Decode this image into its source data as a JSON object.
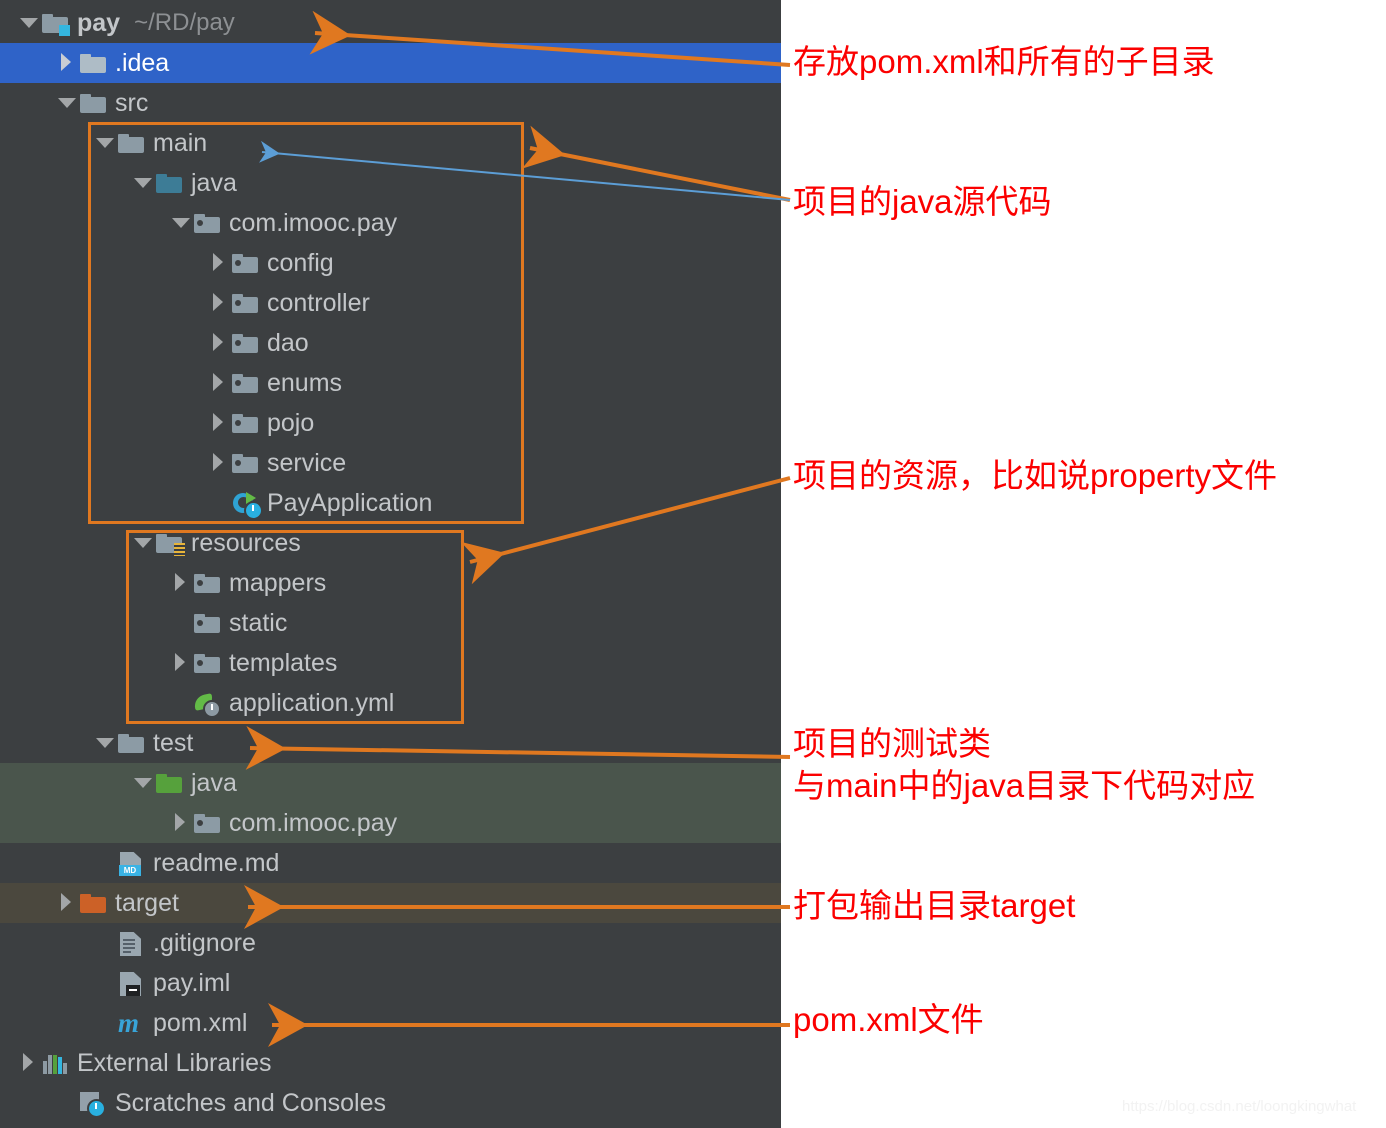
{
  "panel": {
    "background_color": "#3c3f41",
    "selection_color": "#2f63c8",
    "highlight_green": "#4a554c",
    "highlight_brown": "#4b483e"
  },
  "tree": {
    "nodes": [
      {
        "label": "pay",
        "path": "~/RD/pay",
        "icon": "source-root-folder-icon",
        "twisty": "down",
        "indent": 0,
        "state": "normal",
        "bold": true
      },
      {
        "label": ".idea",
        "path": "",
        "icon": "folder-icon",
        "twisty": "right",
        "indent": 1,
        "state": "selected",
        "bold": false
      },
      {
        "label": "src",
        "path": "",
        "icon": "folder-icon",
        "twisty": "down",
        "indent": 1,
        "state": "normal",
        "bold": false
      },
      {
        "label": "main",
        "path": "",
        "icon": "folder-icon",
        "twisty": "down",
        "indent": 2,
        "state": "normal",
        "bold": false
      },
      {
        "label": "java",
        "path": "",
        "icon": "source-folder-icon",
        "twisty": "down",
        "indent": 3,
        "state": "normal",
        "bold": false
      },
      {
        "label": "com.imooc.pay",
        "path": "",
        "icon": "package-icon",
        "twisty": "down",
        "indent": 4,
        "state": "normal",
        "bold": false
      },
      {
        "label": "config",
        "path": "",
        "icon": "package-icon",
        "twisty": "right",
        "indent": 5,
        "state": "normal",
        "bold": false
      },
      {
        "label": "controller",
        "path": "",
        "icon": "package-icon",
        "twisty": "right",
        "indent": 5,
        "state": "normal",
        "bold": false
      },
      {
        "label": "dao",
        "path": "",
        "icon": "package-icon",
        "twisty": "right",
        "indent": 5,
        "state": "normal",
        "bold": false
      },
      {
        "label": "enums",
        "path": "",
        "icon": "package-icon",
        "twisty": "right",
        "indent": 5,
        "state": "normal",
        "bold": false
      },
      {
        "label": "pojo",
        "path": "",
        "icon": "package-icon",
        "twisty": "right",
        "indent": 5,
        "state": "normal",
        "bold": false
      },
      {
        "label": "service",
        "path": "",
        "icon": "package-icon",
        "twisty": "right",
        "indent": 5,
        "state": "normal",
        "bold": false
      },
      {
        "label": "PayApplication",
        "path": "",
        "icon": "spring-boot-class-icon",
        "twisty": "none",
        "indent": 5,
        "state": "normal",
        "bold": false
      },
      {
        "label": "resources",
        "path": "",
        "icon": "resource-root-folder-icon",
        "twisty": "down",
        "indent": 3,
        "state": "normal",
        "bold": false
      },
      {
        "label": "mappers",
        "path": "",
        "icon": "package-icon",
        "twisty": "right",
        "indent": 4,
        "state": "normal",
        "bold": false
      },
      {
        "label": "static",
        "path": "",
        "icon": "package-icon",
        "twisty": "none",
        "indent": 4,
        "state": "normal",
        "bold": false
      },
      {
        "label": "templates",
        "path": "",
        "icon": "package-icon",
        "twisty": "right",
        "indent": 4,
        "state": "normal",
        "bold": false
      },
      {
        "label": "application.yml",
        "path": "",
        "icon": "spring-yaml-icon",
        "twisty": "none",
        "indent": 4,
        "state": "normal",
        "bold": false
      },
      {
        "label": "test",
        "path": "",
        "icon": "folder-icon",
        "twisty": "down",
        "indent": 2,
        "state": "normal",
        "bold": false
      },
      {
        "label": "java",
        "path": "",
        "icon": "test-source-folder-icon",
        "twisty": "down",
        "indent": 3,
        "state": "hl-green",
        "bold": false
      },
      {
        "label": "com.imooc.pay",
        "path": "",
        "icon": "package-icon",
        "twisty": "right",
        "indent": 4,
        "state": "hl-green",
        "bold": false
      },
      {
        "label": "readme.md",
        "path": "",
        "icon": "markdown-file-icon",
        "twisty": "none",
        "indent": 2,
        "state": "normal",
        "bold": false
      },
      {
        "label": "target",
        "path": "",
        "icon": "excluded-folder-icon",
        "twisty": "right",
        "indent": 1,
        "state": "hl-brown",
        "bold": false
      },
      {
        "label": ".gitignore",
        "path": "",
        "icon": "text-file-icon",
        "twisty": "none",
        "indent": 2,
        "state": "normal",
        "bold": false
      },
      {
        "label": "pay.iml",
        "path": "",
        "icon": "module-file-icon",
        "twisty": "none",
        "indent": 2,
        "state": "normal",
        "bold": false
      },
      {
        "label": "pom.xml",
        "path": "",
        "icon": "maven-file-icon",
        "twisty": "none",
        "indent": 2,
        "state": "normal",
        "bold": false
      },
      {
        "label": "External Libraries",
        "path": "",
        "icon": "libraries-icon",
        "twisty": "right",
        "indent": 0,
        "state": "normal",
        "bold": false
      },
      {
        "label": "Scratches and Consoles",
        "path": "",
        "icon": "scratches-icon",
        "twisty": "none",
        "indent": 1,
        "state": "normal",
        "bold": false
      }
    ]
  },
  "annotations": {
    "color": "#fb0000",
    "callout_color": "#e07820",
    "pointer_color": "#5c9ed6",
    "items": [
      {
        "id": "anno-root",
        "text": "存放pom.xml和所有的子目录"
      },
      {
        "id": "anno-main",
        "text": "项目的java源代码"
      },
      {
        "id": "anno-resources",
        "text": "项目的资源，比如说property文件"
      },
      {
        "id": "anno-test-l1",
        "text": "项目的测试类"
      },
      {
        "id": "anno-test-l2",
        "text": "与main中的java目录下代码对应"
      },
      {
        "id": "anno-target",
        "text": "打包输出目录target"
      },
      {
        "id": "anno-pom",
        "text": "pom.xml文件"
      }
    ]
  },
  "watermark": {
    "text": "https://blog.csdn.net/loongkingwhat"
  }
}
